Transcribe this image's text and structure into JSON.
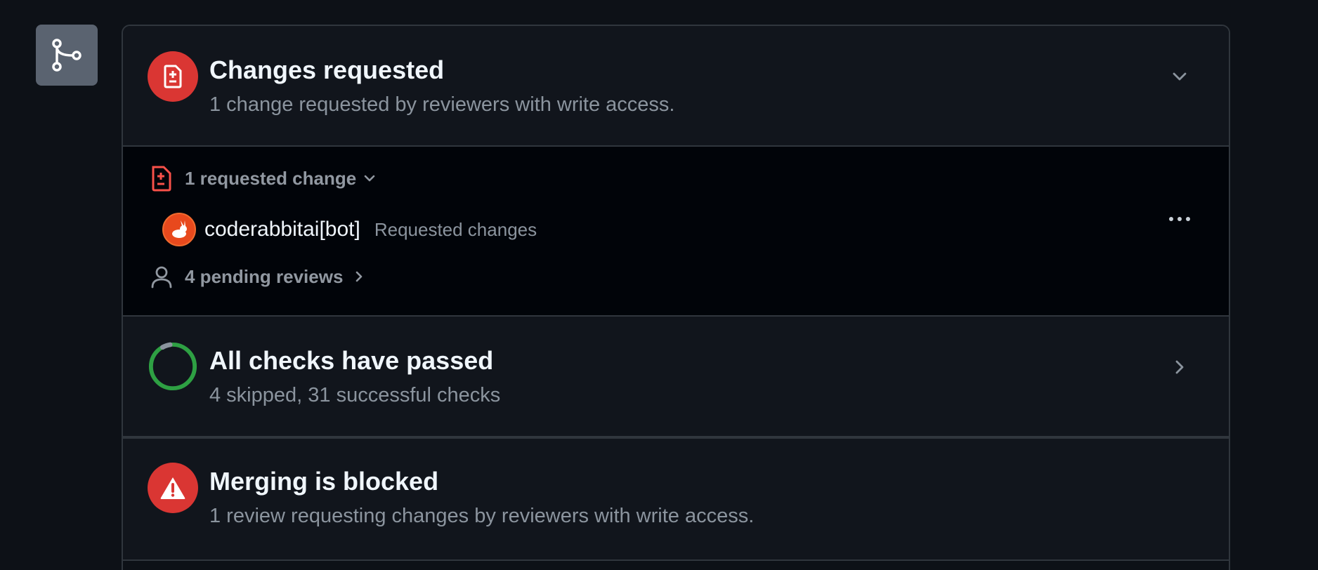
{
  "changes": {
    "title": "Changes requested",
    "subtitle": "1 change requested by reviewers with write access."
  },
  "details": {
    "requested_label": "1 requested change",
    "reviewer": {
      "name": "coderabbitai[bot]",
      "status": "Requested changes"
    },
    "pending_label": "4 pending reviews"
  },
  "checks": {
    "title": "All checks have passed",
    "subtitle": "4 skipped, 31 successful checks"
  },
  "merge": {
    "title": "Merging is blocked",
    "subtitle": "1 review requesting changes by reviewers with write access."
  },
  "colors": {
    "danger": "#da3633",
    "success": "#2ea043",
    "background": "#0d1117"
  }
}
